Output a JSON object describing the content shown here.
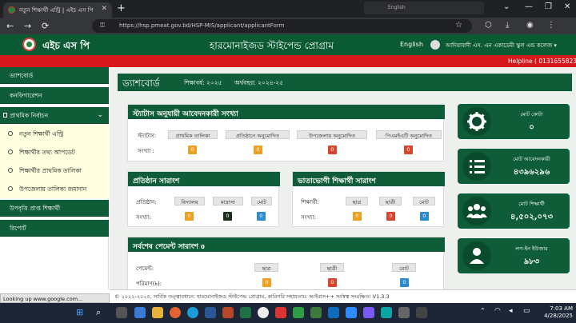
{
  "browser": {
    "tab_title": "নতুন শিক্ষার্থী এন্ট্রি | এইচ এস পি",
    "url": "https://hsp.pmeat.gov.bd/HSP-MIS/applicant/applicantForm",
    "search_hint": "English",
    "new_tab": "+",
    "back": "←",
    "forward": "→",
    "reload": "⟳",
    "star": "☆",
    "lock": "⚿",
    "status_url": "Looking up www.google.com..."
  },
  "header": {
    "brand": "এইচ এস পি",
    "title": "হারমোনাইজড স্টাইপেন্ড প্রোগ্রাম",
    "language": "English",
    "user": "আদিয়াবাদী এস. এন একাডেমী স্কুল এন্ড কলেজ ▾"
  },
  "helpline": "Helpline ( 01316558230, 0",
  "sidebar": {
    "items": [
      {
        "label": "ড্যাশবোর্ড"
      },
      {
        "label": "কনফিগারেশন"
      },
      {
        "label": "প্রাথমিক নির্বাচন"
      },
      {
        "label": "উপবৃত্তি প্রাপ্ত শিক্ষার্থী"
      },
      {
        "label": "রিপোর্ট"
      }
    ],
    "sub_items": [
      {
        "label": "নতুন শিক্ষার্থী এন্ট্রি"
      },
      {
        "label": "শিক্ষার্থীর তথ্য আপডেট"
      },
      {
        "label": "শিক্ষার্থীর প্রাথমিক তালিকা"
      },
      {
        "label": "উপজেলায় তালিকা জমাদান"
      }
    ]
  },
  "dashboard": {
    "title": "ড্যাশবোর্ড",
    "edu_year": "শিক্ষাবর্ষ: ২০২৫",
    "fin_year": "অর্থবছর: ২০২৪-২৫"
  },
  "status_panel": {
    "title": "স্ট্যাটাস অনুযায়ী আবেদনকারী সংখ্যা",
    "status_label": "স্ট্যাটাস:",
    "count_label": "সংখ্যা :",
    "columns": [
      "প্রাথমিক তালিকা",
      "প্রতিষ্ঠানে অনুমোদিত",
      "উপজেলায় অনুমোদিত",
      "পিএমইএটি অনুমোদিত"
    ],
    "values": [
      "0",
      "0",
      "0",
      "0"
    ]
  },
  "institution_panel": {
    "title": "প্রতিষ্ঠান সারাংশ",
    "type_label": "প্রতিষ্ঠান:",
    "count_label": "সংখ্যা:",
    "columns": [
      "বিদ্যালয়",
      "মাদ্রাসা",
      "মোট"
    ],
    "values": [
      "0",
      "0",
      "0"
    ]
  },
  "beneficiary_panel": {
    "title": "ভাতাভোগী শিক্ষার্থী সারাংশ",
    "type_label": "শিক্ষার্থী:",
    "count_label": "সংখ্যা:",
    "columns": [
      "ছাত্র",
      "ছাত্রী",
      "মোট"
    ],
    "values": [
      "0",
      "0",
      "0"
    ]
  },
  "payment_panel": {
    "title": "সর্বশেষ পেমেন্ট সারাংশ",
    "title_suffix": "0",
    "payment_label": "পেমেন্ট:",
    "amount_label": "পরিমাণ(৳):",
    "columns": [
      "ছাত্র",
      "ছাত্রী",
      "মোট"
    ],
    "values": [
      "0",
      "0",
      "0"
    ]
  },
  "stats": [
    {
      "label": "মোট কোটা",
      "value": "০",
      "icon": "gear-icon"
    },
    {
      "label": "মোট আবেদনকারী",
      "value": "৪৩৯৬২৯৬",
      "icon": "list-numbered-icon"
    },
    {
      "label": "মোট শিক্ষার্থী",
      "value": "৪,৫০২,০৭৩",
      "icon": "users-group-icon"
    },
    {
      "label": "লগ-ইন ইউজার",
      "value": "৯৮৩",
      "icon": "user-icon"
    }
  ],
  "footer": "© ২০২২-২০২৫, সার্বিক তত্ত্বাবধানে: হারমোনাইজড স্টাইপেন্ড প্রোগ্রাম, কারিগরি সহায়তায়: আইবাস++ সর্বস্বত্ব সংরক্ষিত। V1.3.3",
  "clock": {
    "time": "7:03 AM",
    "date": "4/28/2025"
  },
  "colors": {
    "primary_green": "#0e5d38",
    "helpline_red": "#d6181c",
    "badge_orange": "#f0a020",
    "badge_red": "#d9452c",
    "badge_blue": "#2a8bd3"
  }
}
